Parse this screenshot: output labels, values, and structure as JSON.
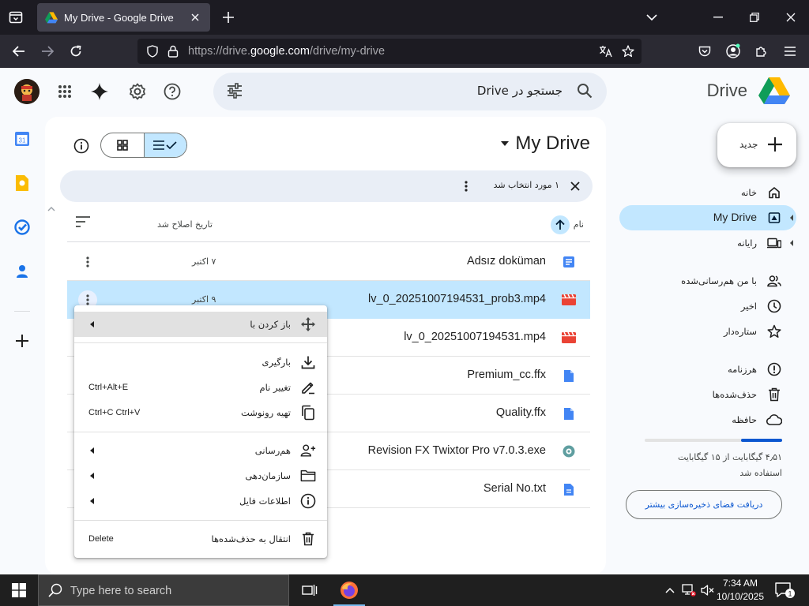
{
  "browser": {
    "tab_title": "My Drive - Google Drive",
    "url_prefix": "https://drive.",
    "url_host": "google.com",
    "url_path": "/drive/my-drive"
  },
  "header": {
    "search_placeholder": "جستجو در Drive",
    "brand": "Drive"
  },
  "main": {
    "title": "My Drive",
    "selection_text": "۱ مورد انتخاب شد",
    "columns": {
      "name": "نام",
      "modified": "تاریخ اصلاح شد"
    },
    "files": [
      {
        "name": "Adsız doküman",
        "date": "۷ اکتبر",
        "type": "doc"
      },
      {
        "name": "lv_0_20251007194531_prob3.mp4",
        "date": "۹ اکتبر",
        "type": "video",
        "selected": true
      },
      {
        "name": "lv_0_20251007194531.mp4",
        "date": "",
        "type": "video"
      },
      {
        "name": "Premium_cc.ffx",
        "date": "",
        "type": "file"
      },
      {
        "name": "Quality.ffx",
        "date": "",
        "type": "file"
      },
      {
        "name": "Revision FX Twixtor Pro v7.0.3.exe",
        "date": "",
        "type": "exe"
      },
      {
        "name": "Serial No.txt",
        "date": "",
        "type": "file"
      }
    ]
  },
  "nav": {
    "new_label": "جدید",
    "items": [
      {
        "label": "خانه",
        "icon": "home-icon"
      },
      {
        "label": "My Drive",
        "icon": "my-drive-icon",
        "active": true
      },
      {
        "label": "رایانه",
        "icon": "computer-icon"
      },
      {
        "label": "با من هم‌رسانی‌شده",
        "icon": "shared-icon"
      },
      {
        "label": "اخیر",
        "icon": "recent-icon"
      },
      {
        "label": "ستاره‌دار",
        "icon": "star-icon"
      },
      {
        "label": "هرزنامه",
        "icon": "spam-icon"
      },
      {
        "label": "حذف‌شده‌ها",
        "icon": "trash-icon"
      },
      {
        "label": "حافظه",
        "icon": "cloud-icon"
      }
    ],
    "storage_used": "۴٫۵۱ گیگابایت از ۱۵ گیگابایت",
    "storage_used_line2": "استفاده شد",
    "storage_fraction": 0.3,
    "storage_button": "دریافت فضای ذخیره‌سازی بیشتر"
  },
  "context_menu": {
    "open_with": "باز کردن با",
    "download": "بارگیری",
    "rename": "تغییر نام",
    "rename_shortcut": "Ctrl+Alt+E",
    "copy": "تهیه رونوشت",
    "copy_shortcut": "Ctrl+C Ctrl+V",
    "share": "هم‌رسانی",
    "organize": "سازمان‌دهی",
    "file_info": "اطلاعات فایل",
    "move_to_trash": "انتقال به حذف‌شده‌ها",
    "trash_shortcut": "Delete"
  },
  "taskbar": {
    "search_placeholder": "Type here to search",
    "time": "7:34 AM",
    "date": "10/10/2025",
    "notifications": "1"
  },
  "colors": {
    "accent": "#0b57d0",
    "selected_bg": "#c2e7ff",
    "doc_blue": "#4285f4",
    "video_red": "#ea4335"
  }
}
